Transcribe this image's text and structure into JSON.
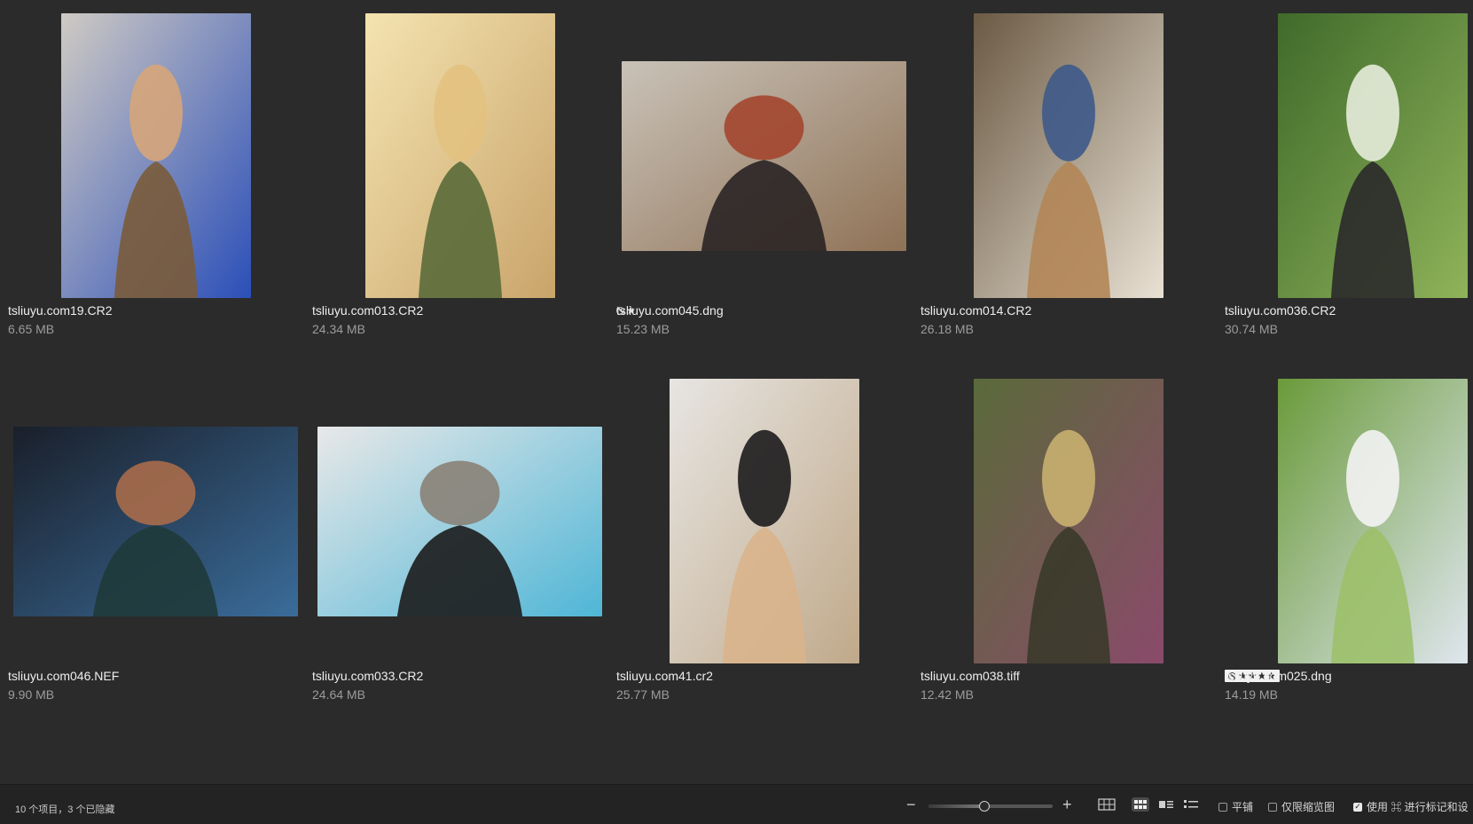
{
  "files": [
    {
      "name": "tsliuyu.com19.CR2",
      "size": "6.65 MB",
      "rating": null,
      "orientation": "portrait",
      "palette": [
        "#cfcac4",
        "#2b4fb8",
        "#d6a57a",
        "#7a5b3a"
      ]
    },
    {
      "name": "tsliuyu.com013.CR2",
      "size": "24.34 MB",
      "rating": null,
      "orientation": "portrait",
      "palette": [
        "#f4e3b0",
        "#c9a46a",
        "#e3c27f",
        "#5a6b3a"
      ]
    },
    {
      "name": "tsliuyu.com045.dng",
      "size": "15.23 MB",
      "rating": {
        "stars": "★",
        "reject": true,
        "boxed": false
      },
      "orientation": "landscape",
      "palette": [
        "#c9c2b8",
        "#8f7256",
        "#a3462f",
        "#2a2324"
      ]
    },
    {
      "name": "tsliuyu.com014.CR2",
      "size": "26.18 MB",
      "rating": null,
      "orientation": "portrait",
      "palette": [
        "#6b5a44",
        "#e9e1d4",
        "#3e5a8a",
        "#b38656"
      ]
    },
    {
      "name": "tsliuyu.com036.CR2",
      "size": "30.74 MB",
      "rating": null,
      "orientation": "portrait",
      "palette": [
        "#3f6a2a",
        "#8fb35a",
        "#e6ecdc",
        "#2a2a2a"
      ]
    },
    {
      "name": "tsliuyu.com046.NEF",
      "size": "9.90 MB",
      "rating": null,
      "orientation": "landscape",
      "palette": [
        "#1a1f2a",
        "#3a6c9a",
        "#a86b4a",
        "#1f3a3a"
      ]
    },
    {
      "name": "tsliuyu.com033.CR2",
      "size": "24.64 MB",
      "rating": null,
      "orientation": "landscape",
      "palette": [
        "#e8e8e8",
        "#4fb6d6",
        "#8a8278",
        "#1c1c1c"
      ]
    },
    {
      "name": "tsliuyu.com41.cr2",
      "size": "25.77 MB",
      "rating": null,
      "orientation": "portrait",
      "palette": [
        "#e7e5e2",
        "#c0a98a",
        "#1d1b1d",
        "#d9b48c"
      ]
    },
    {
      "name": "tsliuyu.com038.tiff",
      "size": "12.42 MB",
      "rating": null,
      "orientation": "portrait",
      "palette": [
        "#5a6a3a",
        "#8a4a6a",
        "#c9b070",
        "#3a3a2a"
      ]
    },
    {
      "name": "tsliuyu.com025.dng",
      "size": "14.19 MB",
      "rating": {
        "stars": "★★★★",
        "reject": true,
        "boxed": true
      },
      "orientation": "portrait",
      "palette": [
        "#6a9a3a",
        "#dfe6ee",
        "#f3f3f3",
        "#9cc06a"
      ]
    }
  ],
  "statusbar": {
    "summary": "10 个项目，3 个已隐藏",
    "zoom_level": 0.45,
    "options": [
      {
        "label": "平铺",
        "checked": false
      },
      {
        "label": "仅限缩览图",
        "checked": false
      },
      {
        "label": "使用 ⌘ 进行标记和设",
        "checked": true
      }
    ]
  }
}
